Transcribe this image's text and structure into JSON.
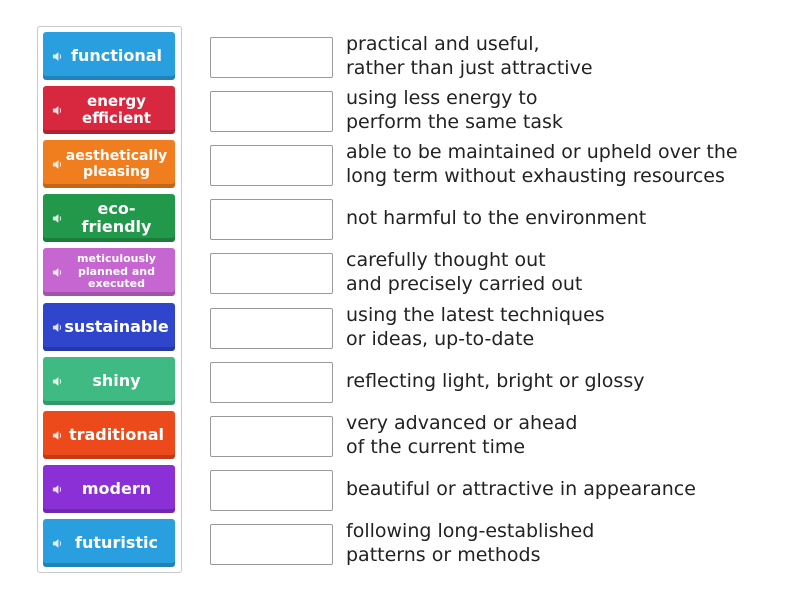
{
  "tiles": [
    {
      "label": "functional",
      "color": "#2a9fe0",
      "size": "16px"
    },
    {
      "label": "energy efficient",
      "color": "#d8283f",
      "size": "15px"
    },
    {
      "label": "aesthetically pleasing",
      "color": "#f07d1e",
      "size": "14px"
    },
    {
      "label": "eco-friendly",
      "color": "#22984a",
      "size": "16px"
    },
    {
      "label": "meticulously planned and executed",
      "color": "#c666d0",
      "size": "11px"
    },
    {
      "label": "sustainable",
      "color": "#2e45cc",
      "size": "16px"
    },
    {
      "label": "shiny",
      "color": "#3fba82",
      "size": "16px"
    },
    {
      "label": "traditional",
      "color": "#ec4a1a",
      "size": "16px"
    },
    {
      "label": "modern",
      "color": "#8a30d6",
      "size": "16px"
    },
    {
      "label": "futuristic",
      "color": "#2a9fe0",
      "size": "16px"
    }
  ],
  "definitions": [
    {
      "line1": "practical and useful,",
      "line2": "rather than just attractive"
    },
    {
      "line1": "using less energy to",
      "line2": "perform the same task"
    },
    {
      "line1": "able to be maintained or upheld over the",
      "line2": "long term without exhausting resources"
    },
    {
      "line1": "not harmful to the environment",
      "line2": ""
    },
    {
      "line1": "carefully thought out",
      "line2": "and precisely carried out"
    },
    {
      "line1": "using the latest techniques",
      "line2": "or ideas, up-to-date"
    },
    {
      "line1": "reflecting light, bright or glossy",
      "line2": ""
    },
    {
      "line1": "very advanced or ahead",
      "line2": "of the current time"
    },
    {
      "line1": "beautiful or attractive in appearance",
      "line2": ""
    },
    {
      "line1": "following long-established",
      "line2": "patterns or methods"
    }
  ],
  "icons": {
    "tile_audio": "speaker-icon"
  }
}
